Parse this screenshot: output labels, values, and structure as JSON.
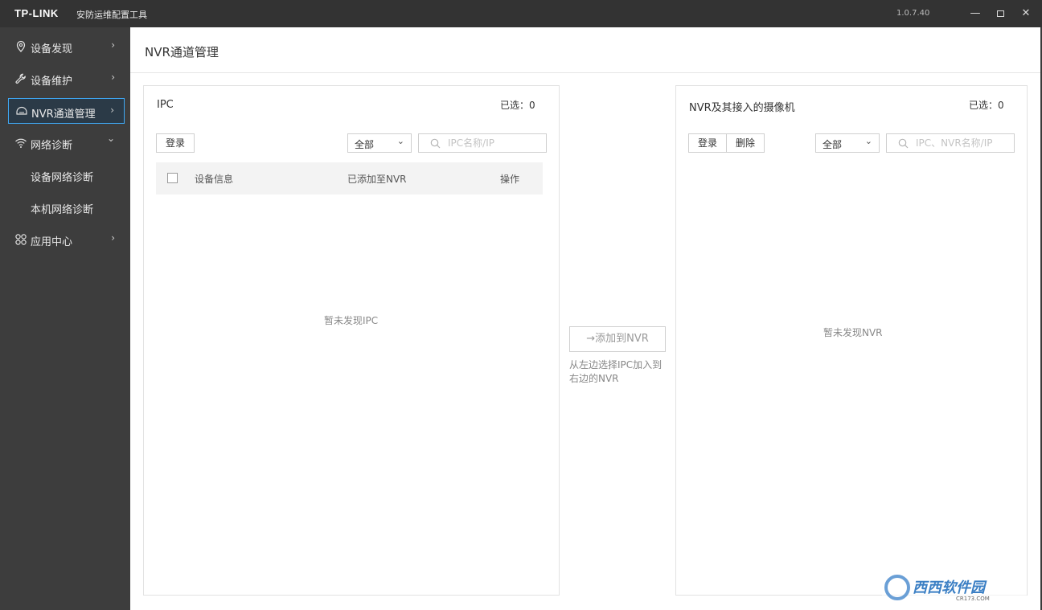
{
  "titlebar": {
    "logo": "TP-LINK",
    "app_title": "安防运维配置工具",
    "version": "1.0.7.40",
    "minimize": "—",
    "close": "✕"
  },
  "sidebar": {
    "items": [
      {
        "label": "设备发现",
        "icon": "location-pin-icon",
        "chevron": "›"
      },
      {
        "label": "设备维护",
        "icon": "wrench-icon",
        "chevron": "›"
      },
      {
        "label": "NVR通道管理",
        "icon": "nvr-device-icon",
        "chevron": "›",
        "active": true
      },
      {
        "label": "网络诊断",
        "icon": "wifi-icon",
        "chevron": "⌄"
      },
      {
        "label": "应用中心",
        "icon": "apps-icon",
        "chevron": "›"
      }
    ],
    "subitems": [
      "设备网络诊断",
      "本机网络诊断"
    ]
  },
  "main": {
    "title": "NVR通道管理",
    "left_panel": {
      "title": "IPC",
      "selected": "已选：0",
      "login_button": "登录",
      "filter_value": "全部",
      "search_placeholder": "IPC名称/IP",
      "columns": [
        "设备信息",
        "已添加至NVR",
        "操作"
      ],
      "empty_text": "暂未发现IPC"
    },
    "add_button": "→添加到NVR",
    "add_hint": "从左边选择IPC加入到右边的NVR",
    "right_panel": {
      "title": "NVR及其接入的摄像机",
      "selected": "已选：0",
      "login_button": "登录",
      "delete_button": "删除",
      "filter_value": "全部",
      "search_placeholder": "IPC、NVR名称/IP",
      "empty_text": "暂未发现NVR"
    }
  },
  "watermark": {
    "text": "西西软件园",
    "subtext": "CR173.COM"
  },
  "colors": {
    "titlebar_bg": "#333333",
    "sidebar_bg": "#3d3d3d",
    "active_border": "#3fa9f5",
    "main_bg": "#ffffff"
  }
}
